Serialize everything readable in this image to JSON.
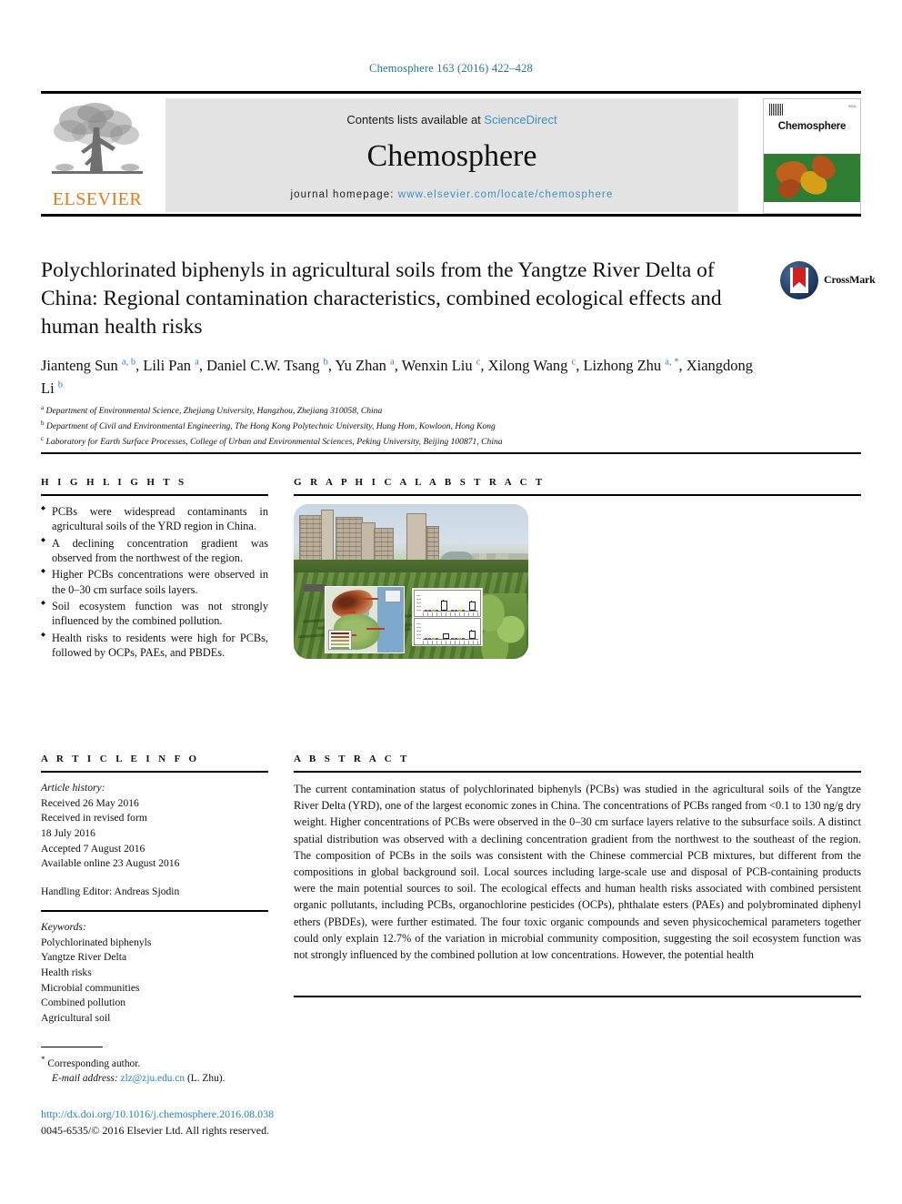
{
  "running_head": "Chemosphere 163 (2016) 422–428",
  "masthead": {
    "contents_prefix": "Contents lists available at ",
    "sciencedirect": "ScienceDirect",
    "journal_name": "Chemosphere",
    "homepage_label": "journal homepage: ",
    "homepage_url": "www.elsevier.com/locate/chemosphere",
    "publisher_logo_text": "ELSEVIER",
    "cover_title": "Chemosphere"
  },
  "article": {
    "title": "Polychlorinated biphenyls in agricultural soils from the Yangtze River Delta of China: Regional contamination characteristics, combined ecological effects and human health risks",
    "crossmark_label": "CrossMark",
    "authors_line": "Jianteng Sun [a,b], Lili Pan [a], Daniel C.W. Tsang [b], Yu Zhan [a], Wenxin Liu [c], Xilong Wang [c], Lizhong Zhu [a,*], Xiangdong Li [b]",
    "authors": [
      {
        "name": "Jianteng Sun",
        "marks": "a, b",
        "sep": ", "
      },
      {
        "name": "Lili Pan",
        "marks": "a",
        "sep": ", "
      },
      {
        "name": "Daniel C.W. Tsang",
        "marks": "b",
        "sep": ", "
      },
      {
        "name": "Yu Zhan",
        "marks": "a",
        "sep": ", "
      },
      {
        "name": "Wenxin Liu",
        "marks": "c",
        "sep": ", "
      },
      {
        "name": "Xilong Wang",
        "marks": "c",
        "sep": ", "
      },
      {
        "name": "Lizhong Zhu",
        "marks": "a, *",
        "sep": ", "
      },
      {
        "name": "Xiangdong Li",
        "marks": "b",
        "sep": ""
      }
    ],
    "affiliations": [
      {
        "mark": "a",
        "text": "Department of Environmental Science, Zhejiang University, Hangzhou, Zhejiang 310058, China"
      },
      {
        "mark": "b",
        "text": "Department of Civil and Environmental Engineering, The Hong Kong Polytechnic University, Hung Hom, Kowloon, Hong Kong"
      },
      {
        "mark": "c",
        "text": "Laboratory for Earth Surface Processes, College of Urban and Environmental Sciences, Peking University, Beijing 100871, China"
      }
    ]
  },
  "highlights": {
    "heading": "H I G H L I G H T S",
    "items": [
      "PCBs were widespread contaminants in agricultural soils of the YRD region in China.",
      "A declining concentration gradient was observed from the northwest of the region.",
      "Higher PCBs concentrations were observed in the 0–30 cm surface soils layers.",
      "Soil ecosystem function was not strongly influenced by the combined pollution.",
      "Health risks to residents were high for PCBs, followed by OCPs, PAEs, and PBDEs."
    ]
  },
  "graphical_abstract": {
    "heading": "G R A P H I C A L   A B S T R A C T",
    "figure_description": "Photograph of high-rise residential buildings behind agricultural vegetable fields, overlaid with an inset spatial distribution map of the Yangtze River Delta and two box-plot panels"
  },
  "article_info": {
    "heading": "A R T I C L E   I N F O",
    "history_label": "Article history:",
    "history": [
      "Received 26 May 2016",
      "Received in revised form",
      "18 July 2016",
      "Accepted 7 August 2016",
      "Available online 23 August 2016"
    ],
    "handling_editor": "Handling Editor: Andreas Sjodin",
    "keywords_label": "Keywords:",
    "keywords": [
      "Polychlorinated biphenyls",
      "Yangtze River Delta",
      "Health risks",
      "Microbial communities",
      "Combined pollution",
      "Agricultural soil"
    ]
  },
  "abstract": {
    "heading": "A B S T R A C T",
    "text": "The current contamination status of polychlorinated biphenyls (PCBs) was studied in the agricultural soils of the Yangtze River Delta (YRD), one of the largest economic zones in China. The concentrations of PCBs ranged from <0.1 to 130 ng/g dry weight. Higher concentrations of PCBs were observed in the 0–30 cm surface layers relative to the subsurface soils. A distinct spatial distribution was observed with a declining concentration gradient from the northwest to the southeast of the region. The composition of PCBs in the soils was consistent with the Chinese commercial PCB mixtures, but different from the compositions in global background soil. Local sources including large-scale use and disposal of PCB-containing products were the main potential sources to soil. The ecological effects and human health risks associated with combined persistent organic pollutants, including PCBs, organochlorine pesticides (OCPs), phthalate esters (PAEs) and polybrominated diphenyl ethers (PBDEs), were further estimated. The four toxic organic compounds and seven physicochemical parameters together could only explain 12.7% of the variation in microbial community composition, suggesting the soil ecosystem function was not strongly influenced by the combined pollution at low concentrations. However, the potential health"
  },
  "footer": {
    "corresponding_star": "*",
    "corresponding_label": "Corresponding author.",
    "email_label": "E-mail address:",
    "email": "zlz@zju.edu.cn",
    "email_suffix": "(L. Zhu).",
    "doi_url": "http://dx.doi.org/10.1016/j.chemosphere.2016.08.038",
    "copyright": "0045-6535/© 2016 Elsevier Ltd. All rights reserved."
  },
  "colors": {
    "link_blue": "#2a7fb8",
    "elsevier_orange": "#e77817",
    "masthead_grey": "#e3e3e3",
    "crossmark_blue": "#1d3f6e",
    "crossmark_red": "#cc2222"
  }
}
